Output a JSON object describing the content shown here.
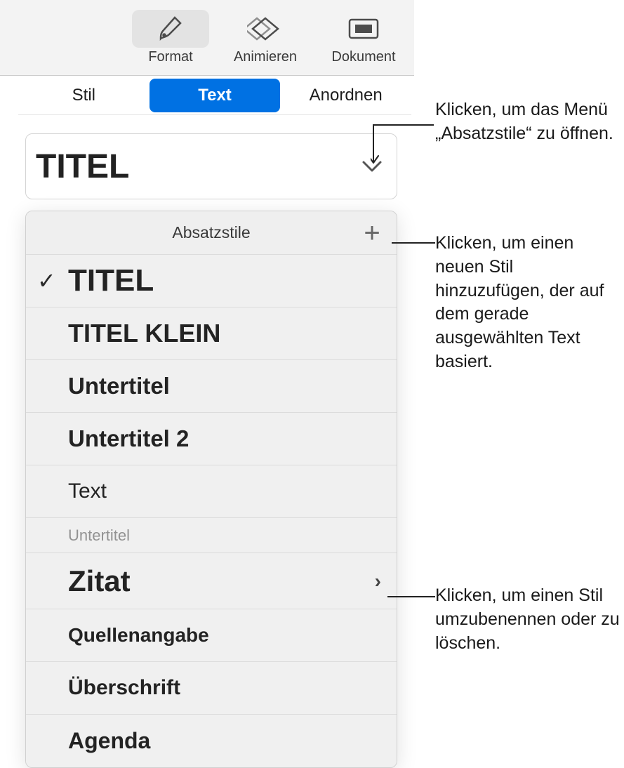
{
  "toolbar": {
    "format_label": "Format",
    "animate_label": "Animieren",
    "document_label": "Dokument"
  },
  "tabs": {
    "style_label": "Stil",
    "text_label": "Text",
    "arrange_label": "Anordnen"
  },
  "paragraph_selector": {
    "current": "TITEL"
  },
  "dropdown": {
    "header": "Absatzstile",
    "items": [
      {
        "label": "TITEL",
        "variant": "titel",
        "checked": true
      },
      {
        "label": "TITEL KLEIN",
        "variant": "titelklein",
        "checked": false
      },
      {
        "label": "Untertitel",
        "variant": "untertitel",
        "checked": false
      },
      {
        "label": "Untertitel 2",
        "variant": "untertitel2",
        "checked": false
      },
      {
        "label": "Text",
        "variant": "text",
        "checked": false
      },
      {
        "label": "Untertitel",
        "variant": "caption",
        "checked": false
      },
      {
        "label": "Zitat",
        "variant": "zitat",
        "checked": false,
        "disclosure": true
      },
      {
        "label": "Quellenangabe",
        "variant": "quelle",
        "checked": false
      },
      {
        "label": "Überschrift",
        "variant": "ueber",
        "checked": false
      },
      {
        "label": "Agenda",
        "variant": "agenda",
        "checked": false
      }
    ]
  },
  "callouts": {
    "open_menu": "Klicken, um das Menü „Absatzstile“ zu öffnen.",
    "add_style": "Klicken, um einen neuen Stil hinzuzufügen, der auf dem gerade ausgewählten Text basiert.",
    "rename_delete": "Klicken, um einen Stil umzubenennen oder zu löschen."
  }
}
